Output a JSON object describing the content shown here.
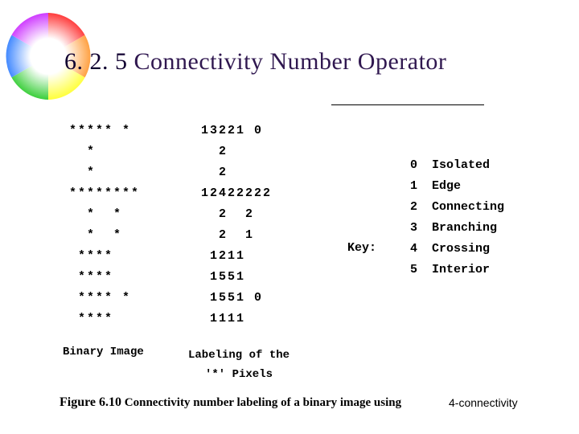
{
  "title": {
    "section": "6. 2. 5",
    "text": "Connectivity Number Operator"
  },
  "binary_rows": [
    "***** *",
    "  *",
    "  *",
    "********",
    "  *  *",
    "  *  *",
    " ****",
    " ****",
    " **** *",
    " ****"
  ],
  "labeling_rows": [
    "13221 0",
    "  2",
    "  2",
    "12422222",
    "  2  2",
    "  2  1",
    " 1211",
    " 1551",
    " 1551 0",
    " 1111"
  ],
  "key_label": "Key:",
  "key_rows": [
    "0  Isolated",
    "1  Edge",
    "2  Connecting",
    "3  Branching",
    "4  Crossing",
    "5  Interior"
  ],
  "captions": {
    "binary": "Binary Image",
    "labeling_line1": "Labeling of the",
    "labeling_line2": "'*' Pixels"
  },
  "figure": {
    "number": "Figure 6.10",
    "text": "Connectivity number labeling of a binary image using",
    "suffix": "4-connectivity"
  }
}
